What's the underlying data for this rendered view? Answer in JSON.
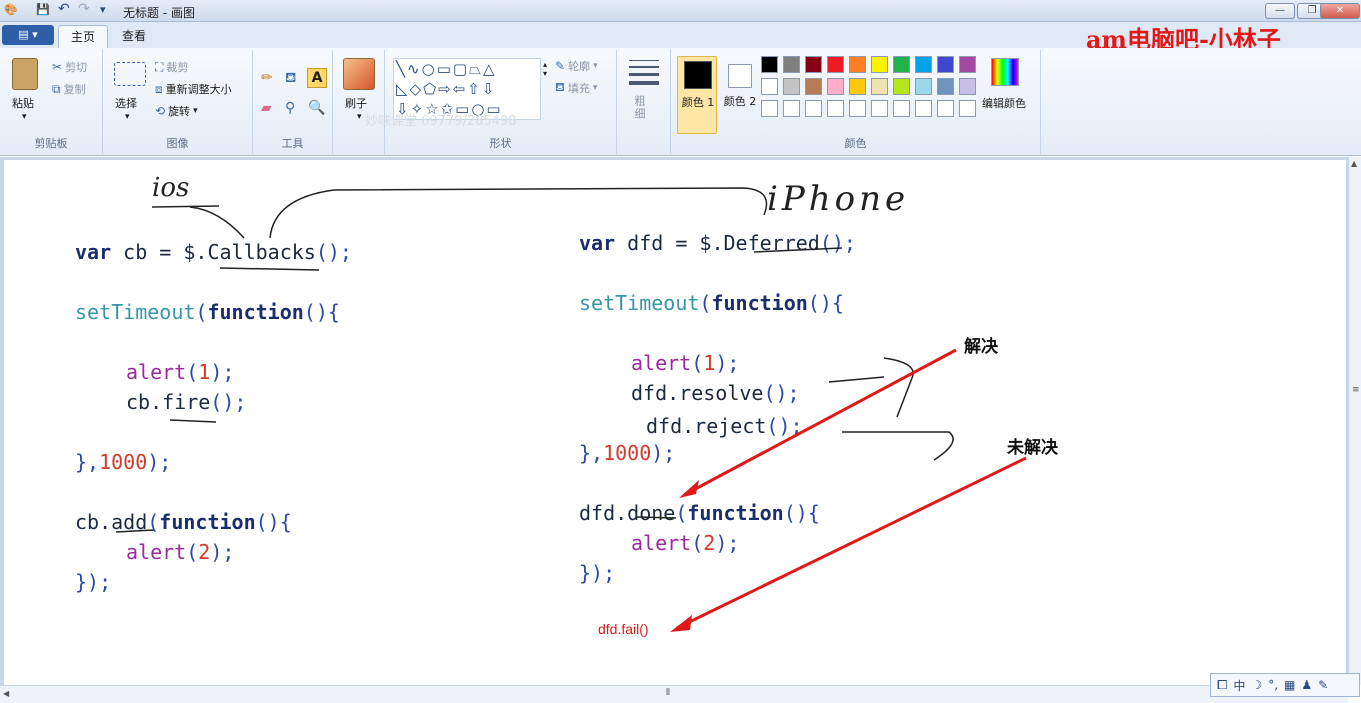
{
  "window": {
    "title": "无标题 - 画图",
    "controls": {
      "minimize": "—",
      "maximize": "❐",
      "close": "✕"
    }
  },
  "tabs": {
    "file": "▤ ▾",
    "home": "主页",
    "view": "查看"
  },
  "watermark": "am电脑吧-小林子",
  "help": "?",
  "ribbon": {
    "clipboard": {
      "paste": "粘贴",
      "cut": "剪切",
      "copy": "复制",
      "label": "剪贴板"
    },
    "image": {
      "select": "选择",
      "crop": "裁剪",
      "resize": "重新调整大小",
      "rotate": "旋转",
      "label": "图像"
    },
    "tools": {
      "label": "工具",
      "text_tool": "A"
    },
    "brush": {
      "label": "刷子"
    },
    "shapes": {
      "outline": "轮廓",
      "fill": "填充",
      "label": "形状",
      "overlay_text": "妙味课堂 69779/285498"
    },
    "size": {
      "label": "粗细"
    },
    "colors": {
      "color1": "颜色 1",
      "color2": "颜色 2",
      "edit": "编辑颜色",
      "label": "颜色",
      "palette_row1": [
        "#000000",
        "#7f7f7f",
        "#880015",
        "#ed1c24",
        "#ff7f27",
        "#fff200",
        "#22b14c",
        "#00a2e8",
        "#3f48cc",
        "#a349a4"
      ],
      "palette_row2": [
        "#ffffff",
        "#c3c3c3",
        "#b97a57",
        "#ffaec9",
        "#ffc90e",
        "#efe4b0",
        "#b5e61d",
        "#99d9ea",
        "#7092be",
        "#c8bfe7"
      ]
    }
  },
  "canvas": {
    "left_code": {
      "l1": [
        "var",
        " cb = $.",
        "Callbacks",
        "();"
      ],
      "l2": [
        "setTimeout",
        "(",
        "function",
        "(){"
      ],
      "l3": [
        "alert",
        "(",
        "1",
        ");"
      ],
      "l4": [
        "cb.",
        "fire",
        "();"
      ],
      "l5": [
        "},",
        "1000",
        ");"
      ],
      "l6": [
        "cb.",
        "add",
        "(",
        "function",
        "(){"
      ],
      "l7": [
        "alert",
        "(",
        "2",
        ");"
      ],
      "l8": [
        "});"
      ]
    },
    "right_code": {
      "r1": [
        "var",
        " dfd = $.",
        "Deferred",
        "();"
      ],
      "r2": [
        "setTimeout",
        "(",
        "function",
        "(){"
      ],
      "r3": [
        "alert",
        "(",
        "1",
        ");"
      ],
      "r4": [
        "dfd.",
        "resolve",
        "();"
      ],
      "r5": [
        "dfd.",
        "reject",
        "();"
      ],
      "r6": [
        "},",
        "1000",
        ");"
      ],
      "r7": [
        "dfd.",
        "done",
        "(",
        "function",
        "(){"
      ],
      "r8": [
        "alert",
        "(",
        "2",
        ");"
      ],
      "r9": [
        "});"
      ]
    },
    "handwriting": {
      "ios": "ios",
      "iphone": "iPhone"
    },
    "annotations": {
      "resolved": "解决",
      "unresolved": "未解决",
      "fail": "dfd.fail()"
    }
  },
  "ime": {
    "lang": "中",
    "items": [
      "☽",
      "°,",
      "▦",
      "♟",
      "✎"
    ]
  }
}
